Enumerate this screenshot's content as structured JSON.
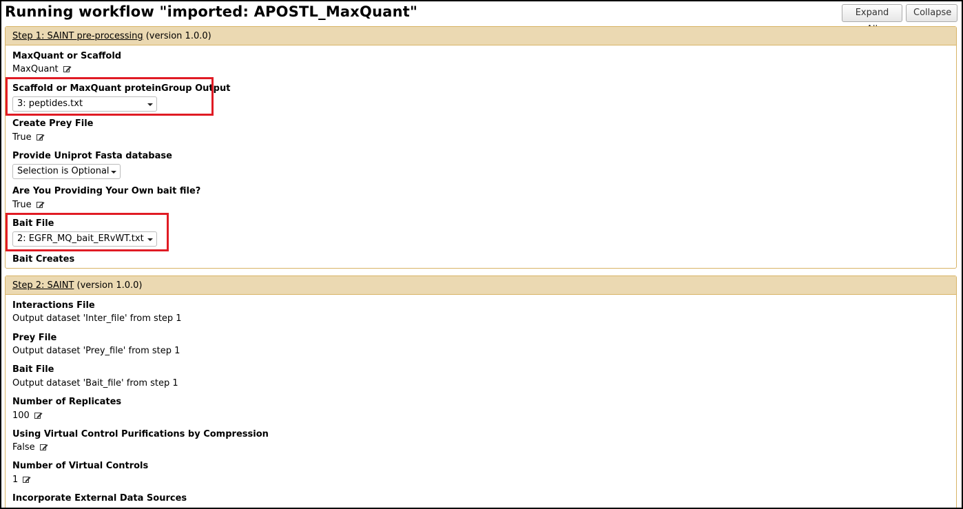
{
  "page": {
    "title": "Running workflow \"imported: APOSTL_MaxQuant\"",
    "expand_label": "Expand All",
    "collapse_label": "Collapse"
  },
  "step1": {
    "title_link": "Step 1: SAINT pre-processing",
    "version": " (version 1.0.0)",
    "fields": [
      {
        "label": "MaxQuant or Scaffold",
        "value": "MaxQuant"
      },
      {
        "label": "Scaffold or MaxQuant proteinGroup Output",
        "value": "3: peptides.txt"
      },
      {
        "label": "Create Prey File",
        "value": "True"
      },
      {
        "label": "Provide Uniprot Fasta database",
        "value": "Selection is Optional"
      },
      {
        "label": "Are You Providing Your Own bait file?",
        "value": "True"
      },
      {
        "label": "Bait File",
        "value": "2: EGFR_MQ_bait_ERvWT.txt"
      },
      {
        "label": "Bait Creates",
        "value": ""
      }
    ]
  },
  "step2": {
    "title_link": "Step 2: SAINT",
    "version": " (version 1.0.0)",
    "fields": [
      {
        "label": "Interactions File",
        "value": "Output dataset 'Inter_file' from step 1"
      },
      {
        "label": "Prey File",
        "value": "Output dataset 'Prey_file' from step 1"
      },
      {
        "label": "Bait File",
        "value": "Output dataset 'Bait_file' from step 1"
      },
      {
        "label": "Number of Replicates",
        "value": "100"
      },
      {
        "label": "Using Virtual Control Purifications by Compression",
        "value": "False"
      },
      {
        "label": "Number of Virtual Controls",
        "value": "1"
      },
      {
        "label": "Incorporate External Data Sources",
        "value": ""
      }
    ]
  },
  "colors": {
    "step_header_bg": "#ebd9b2",
    "step_border": "#d8b365",
    "highlight": "#e01b24"
  },
  "icons": {
    "edit": "edit-icon"
  }
}
